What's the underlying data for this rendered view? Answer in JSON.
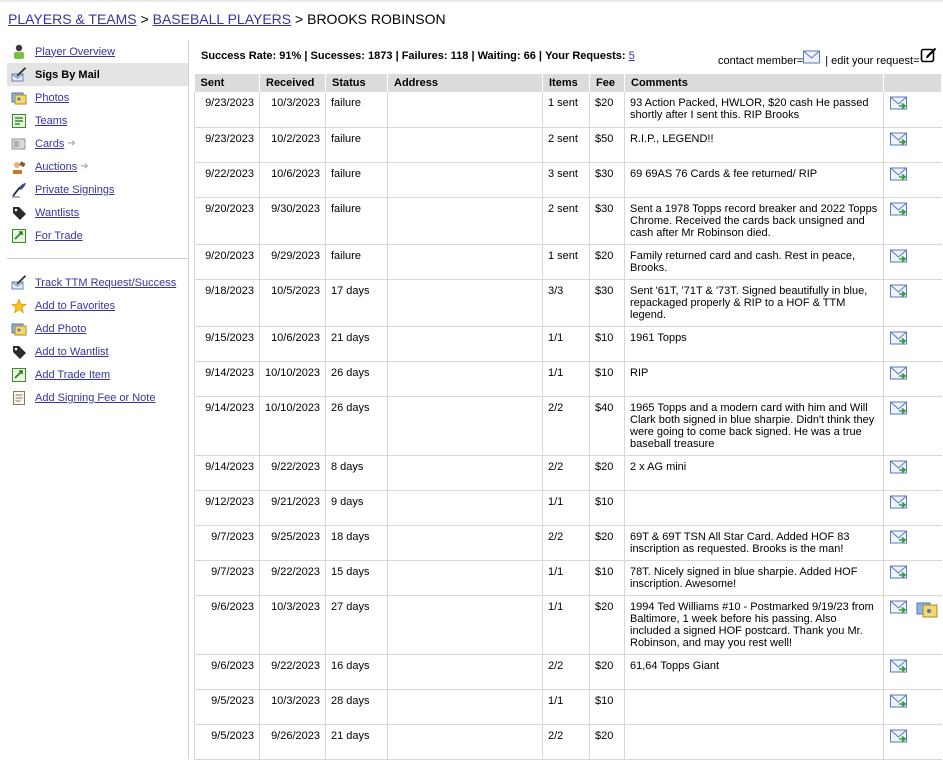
{
  "breadcrumb": {
    "players_teams": "PLAYERS & TEAMS",
    "separator": ">",
    "baseball_players": "BASEBALL PLAYERS",
    "current": "BROOKS ROBINSON"
  },
  "sidebar": {
    "primary": [
      {
        "label": "Player Overview",
        "icon": "player-icon"
      },
      {
        "label": "Sigs By Mail",
        "icon": "pen-mail-icon",
        "active": true
      },
      {
        "label": "Photos",
        "icon": "photos-icon"
      },
      {
        "label": "Teams",
        "icon": "teams-icon"
      },
      {
        "label": "Cards",
        "icon": "cards-icon",
        "arrow": true
      },
      {
        "label": "Auctions",
        "icon": "gavel-icon",
        "arrow": true
      },
      {
        "label": "Private Signings",
        "icon": "quill-icon"
      },
      {
        "label": "Wantlists",
        "icon": "tag-icon"
      },
      {
        "label": "For Trade",
        "icon": "trade-icon"
      }
    ],
    "secondary": [
      {
        "label": "Track TTM Request/Success",
        "icon": "pen-mail-icon"
      },
      {
        "label": "Add to Favorites",
        "icon": "star-icon"
      },
      {
        "label": "Add Photo",
        "icon": "photos-icon"
      },
      {
        "label": "Add to Wantlist",
        "icon": "tag-icon"
      },
      {
        "label": "Add Trade Item",
        "icon": "trade-icon"
      },
      {
        "label": "Add Signing Fee or Note",
        "icon": "note-icon"
      }
    ]
  },
  "stats": {
    "success_rate_label": "Success Rate:",
    "success_rate": "91%",
    "successes_label": "Sucesses:",
    "successes": "1873",
    "failures_label": "Failures:",
    "failures": "118",
    "waiting_label": "Waiting:",
    "waiting": "66",
    "requests_label": "Your Requests:",
    "requests": "5",
    "sep": "|"
  },
  "legend": {
    "contact_label": "contact member=",
    "sep": "|",
    "edit_label": "edit your request="
  },
  "table": {
    "headers": [
      "Sent",
      "Received",
      "Status",
      "Address",
      "Items",
      "Fee",
      "Comments"
    ],
    "rows": [
      {
        "sent": "9/23/2023",
        "received": "10/3/2023",
        "status": "failure",
        "address": "",
        "items": "1 sent",
        "fee": "$20",
        "comments": "93 Action Packed, HWLOR, $20 cash He passed shortly after I sent this. RIP Brooks",
        "h": 35
      },
      {
        "sent": "9/23/2023",
        "received": "10/2/2023",
        "status": "failure",
        "address": "",
        "items": "2 sent",
        "fee": "$50",
        "comments": "R.I.P., LEGEND!!",
        "h": 35
      },
      {
        "sent": "9/22/2023",
        "received": "10/6/2023",
        "status": "failure",
        "address": "",
        "items": "3 sent",
        "fee": "$30",
        "comments": "69 69AS 76 Cards & fee returned/ RIP",
        "h": 35
      },
      {
        "sent": "9/20/2023",
        "received": "9/30/2023",
        "status": "failure",
        "address": "",
        "items": "2 sent",
        "fee": "$30",
        "comments": "Sent a 1978 Topps record breaker and 2022 Topps Chrome. Received the cards back unsigned and cash after Mr Robinson died.",
        "h": 47
      },
      {
        "sent": "9/20/2023",
        "received": "9/29/2023",
        "status": "failure",
        "address": "",
        "items": "1 sent",
        "fee": "$20",
        "comments": "Family returned card and cash. Rest in peace, Brooks.",
        "h": 35
      },
      {
        "sent": "9/18/2023",
        "received": "10/5/2023",
        "status": "17 days",
        "address": "",
        "items": "3/3",
        "fee": "$30",
        "comments": "Sent '61T, '71T & '73T. Signed beautifully in blue, repackaged properly & RIP to a HOF & TTM legend.",
        "h": 47
      },
      {
        "sent": "9/15/2023",
        "received": "10/6/2023",
        "status": "21 days",
        "address": "",
        "items": "1/1",
        "fee": "$10",
        "comments": "1961 Topps",
        "h": 35
      },
      {
        "sent": "9/14/2023",
        "received": "10/10/2023",
        "status": "26 days",
        "address": "",
        "items": "1/1",
        "fee": "$10",
        "comments": "RIP",
        "h": 35
      },
      {
        "sent": "9/14/2023",
        "received": "10/10/2023",
        "status": "26 days",
        "address": "",
        "items": "2/2",
        "fee": "$40",
        "comments": "1965 Topps and a modern card with him and Will Clark both signed in blue sharpie. Didn't think they were going to come back signed. He was a true baseball treasure",
        "h": 59
      },
      {
        "sent": "9/14/2023",
        "received": "9/22/2023",
        "status": "8 days",
        "address": "",
        "items": "2/2",
        "fee": "$20",
        "comments": "2 x AG mini",
        "h": 35
      },
      {
        "sent": "9/12/2023",
        "received": "9/21/2023",
        "status": "9 days",
        "address": "",
        "items": "1/1",
        "fee": "$10",
        "comments": "",
        "h": 35
      },
      {
        "sent": "9/7/2023",
        "received": "9/25/2023",
        "status": "18 days",
        "address": "",
        "items": "2/2",
        "fee": "$20",
        "comments": "69T & 69T TSN All Star Card. Added HOF 83 inscription as requested. Brooks is the man!",
        "h": 35
      },
      {
        "sent": "9/7/2023",
        "received": "9/22/2023",
        "status": "15 days",
        "address": "",
        "items": "1/1",
        "fee": "$10",
        "comments": "78T. Nicely signed in blue sharpie. Added HOF inscription. Awesome!",
        "h": 35
      },
      {
        "sent": "9/6/2023",
        "received": "10/3/2023",
        "status": "27 days",
        "address": "",
        "items": "1/1",
        "fee": "$20",
        "comments": "1994 Ted Williams #10 - Postmarked 9/19/23 from Baltimore, 1 week before his passing. Also included a signed HOF postcard. Thank you Mr. Robinson, and may you rest well!",
        "h": 59,
        "photo": true
      },
      {
        "sent": "9/6/2023",
        "received": "9/22/2023",
        "status": "16 days",
        "address": "",
        "items": "2/2",
        "fee": "$20",
        "comments": "61,64 Topps Giant",
        "h": 35
      },
      {
        "sent": "9/5/2023",
        "received": "10/3/2023",
        "status": "28 days",
        "address": "",
        "items": "1/1",
        "fee": "$10",
        "comments": "",
        "h": 35
      },
      {
        "sent": "9/5/2023",
        "received": "9/26/2023",
        "status": "21 days",
        "address": "",
        "items": "2/2",
        "fee": "$20",
        "comments": "",
        "h": 35
      }
    ]
  }
}
